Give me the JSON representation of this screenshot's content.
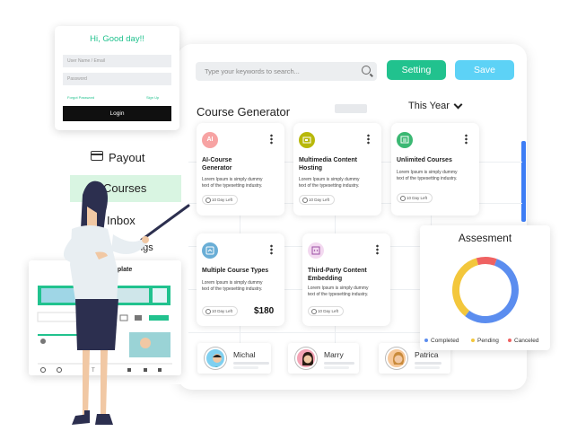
{
  "search": {
    "placeholder": "Type your keywords to search..."
  },
  "toolbar": {
    "setting_label": "Setting",
    "save_label": "Save"
  },
  "section": {
    "title": "Course Generator",
    "period": "This Year"
  },
  "courses": [
    {
      "icon_text": "AI",
      "icon_color": "#f7a3a3",
      "title_l1": "AI-Course",
      "title_l2": "Generator",
      "desc_l1": "Lorem Ipsum is simply dummy",
      "desc_l2": "text of the typesetting industry.",
      "day": "10 Day Left"
    },
    {
      "icon_text": "",
      "icon_color": "#b8b80a",
      "title_l1": "Multimedia Content",
      "title_l2": "Hosting",
      "desc_l1": "Lorem Ipsum is simply dummy",
      "desc_l2": "text of the typesetting industry.",
      "day": "10 Day Left"
    },
    {
      "icon_text": "",
      "icon_color": "#3bb873",
      "title_l1": "Unlimited Courses",
      "title_l2": "",
      "desc_l1": "Lorem Ipsum is simply dummy",
      "desc_l2": "text of the typesetting industry.",
      "day": "10 Day Left"
    },
    {
      "icon_text": "",
      "icon_color": "#6aaed6",
      "title_l1": "Multiple Course Types",
      "title_l2": "",
      "desc_l1": "Lorem Ipsum is simply dummy",
      "desc_l2": "text of the typesetting industry.",
      "day": "10 Day Left",
      "price": "$180"
    },
    {
      "icon_text": "",
      "icon_color": "#f3d9f0",
      "title_l1": "Third-Party Content",
      "title_l2": "Embedding",
      "desc_l1": "Lorem Ipsum is simply dummy",
      "desc_l2": "text of the typesetting industry.",
      "day": "10 Day Left"
    }
  ],
  "users": [
    {
      "name": "Michal",
      "avatar_bg": "#7fd0f0"
    },
    {
      "name": "Marry",
      "avatar_bg": "#f4a3b5"
    },
    {
      "name": "Patrica",
      "avatar_bg": "#f6c89a"
    }
  ],
  "assessment": {
    "title": "Assesment",
    "legend": [
      {
        "label": "Completed",
        "color": "#5b8def"
      },
      {
        "label": "Pending",
        "color": "#f3c73c"
      },
      {
        "label": "Canceled",
        "color": "#ef6262"
      }
    ]
  },
  "chart_data": {
    "type": "pie",
    "categories": [
      "Completed",
      "Pending",
      "Canceled"
    ],
    "values": [
      55,
      35,
      10
    ],
    "title": "Assesment"
  },
  "login": {
    "title": "Hi, Good day!!",
    "username_placeholder": "User Name / Email",
    "password_placeholder": "Password",
    "forgot_label": "Forgot Password",
    "signup_label": "Sign Up",
    "button_label": "Login"
  },
  "sidebar": {
    "items": [
      {
        "label": "Payout"
      },
      {
        "label": "Courses"
      },
      {
        "label": "Inbox"
      },
      {
        "label": "Settings"
      }
    ]
  },
  "template": {
    "title": "Template"
  },
  "colors": {
    "accent": "#21c28e",
    "save": "#5dd2f6",
    "active_menu": "#d9f5e2"
  }
}
